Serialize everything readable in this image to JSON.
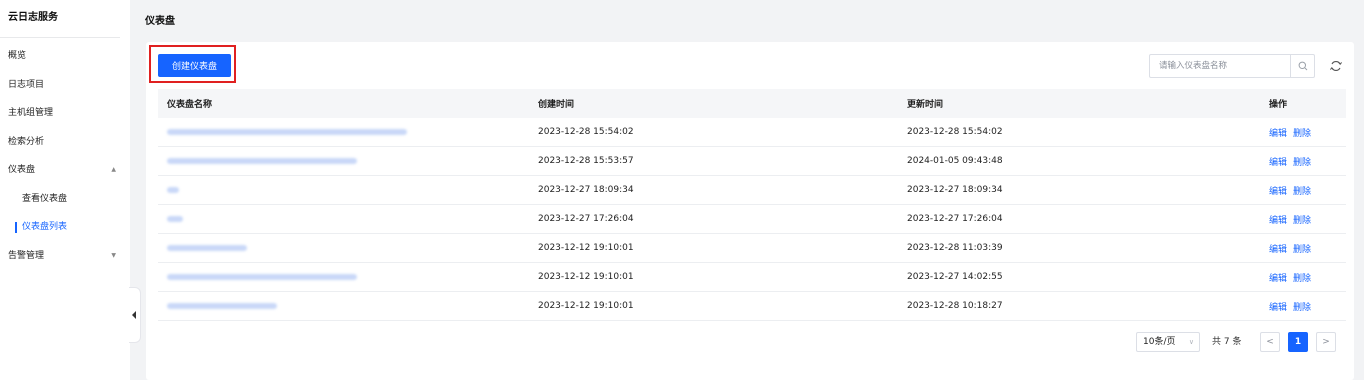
{
  "sidebar": {
    "brand": "云日志服务",
    "items": [
      {
        "label": "概览"
      },
      {
        "label": "日志项目"
      },
      {
        "label": "主机组管理"
      },
      {
        "label": "检索分析"
      },
      {
        "label": "仪表盘",
        "caret": "▲"
      },
      {
        "label": "查看仪表盘"
      },
      {
        "label": "仪表盘列表"
      },
      {
        "label": "告警管理",
        "caret": "▼"
      }
    ]
  },
  "header": {
    "title": "仪表盘"
  },
  "toolbar": {
    "create_label": "创建仪表盘",
    "search_placeholder": "请输入仪表盘名称"
  },
  "table": {
    "columns": [
      "仪表盘名称",
      "创建时间",
      "更新时间",
      "操作"
    ],
    "rows": [
      {
        "created": "2023-12-28 15:54:02",
        "updated": "2023-12-28 15:54:02"
      },
      {
        "created": "2023-12-28 15:53:57",
        "updated": "2024-01-05 09:43:48"
      },
      {
        "created": "2023-12-27 18:09:34",
        "updated": "2023-12-27 18:09:34"
      },
      {
        "created": "2023-12-27 17:26:04",
        "updated": "2023-12-27 17:26:04"
      },
      {
        "created": "2023-12-12 19:10:01",
        "updated": "2023-12-28 11:03:39"
      },
      {
        "created": "2023-12-12 19:10:01",
        "updated": "2023-12-27 14:02:55"
      },
      {
        "created": "2023-12-12 19:10:01",
        "updated": "2023-12-28 10:18:27"
      }
    ],
    "actions": {
      "edit": "编辑",
      "delete": "删除"
    }
  },
  "pagination": {
    "page_size": "10条/页",
    "total": "共 7 条",
    "prev": "<",
    "current": "1",
    "next": ">"
  },
  "colors": {
    "accent": "#1664ff",
    "highlight_border": "#e02020"
  }
}
